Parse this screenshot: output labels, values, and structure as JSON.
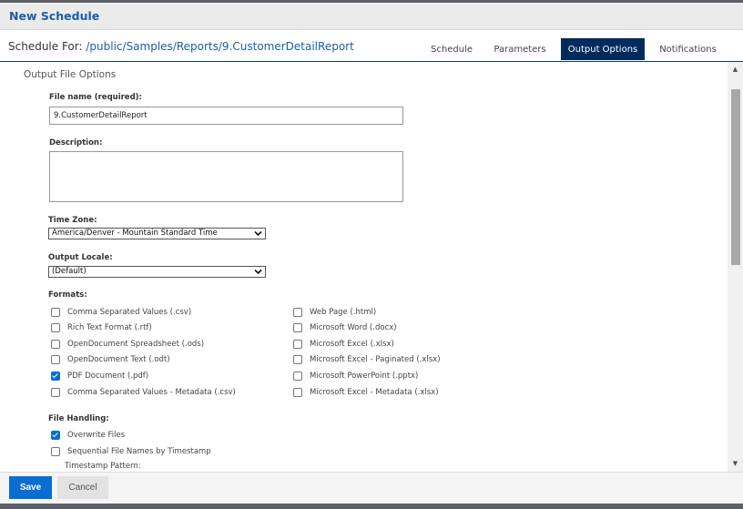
{
  "dialog": {
    "title": "New Schedule"
  },
  "header": {
    "schedule_for_label": "Schedule For:",
    "report_path": "/public/Samples/Reports/9.CustomerDetailReport",
    "tabs": [
      {
        "label": "Schedule",
        "active": false
      },
      {
        "label": "Parameters",
        "active": false
      },
      {
        "label": "Output Options",
        "active": true
      },
      {
        "label": "Notifications",
        "active": false
      }
    ]
  },
  "output": {
    "section_title": "Output File Options",
    "file_name_label": "File name (required):",
    "file_name_value": "9.CustomerDetailReport",
    "description_label": "Description:",
    "description_value": "",
    "timezone_label": "Time Zone:",
    "timezone_value": "America/Denver - Mountain Standard Time",
    "locale_label": "Output Locale:",
    "locale_value": "(Default)",
    "formats_label": "Formats:",
    "formats_left": [
      {
        "label": "Comma Separated Values (.csv)",
        "checked": false
      },
      {
        "label": "Rich Text Format (.rtf)",
        "checked": false
      },
      {
        "label": "OpenDocument Spreadsheet (.ods)",
        "checked": false
      },
      {
        "label": "OpenDocument Text (.odt)",
        "checked": false
      },
      {
        "label": "PDF Document (.pdf)",
        "checked": true
      },
      {
        "label": "Comma Separated Values - Metadata (.csv)",
        "checked": false
      }
    ],
    "formats_right": [
      {
        "label": "Web Page (.html)",
        "checked": false
      },
      {
        "label": "Microsoft Word (.docx)",
        "checked": false
      },
      {
        "label": "Microsoft Excel (.xlsx)",
        "checked": false
      },
      {
        "label": "Microsoft Excel - Paginated (.xlsx)",
        "checked": false
      },
      {
        "label": "Microsoft PowerPoint (.pptx)",
        "checked": false
      },
      {
        "label": "Microsoft Excel - Metadata (.xlsx)",
        "checked": false
      }
    ],
    "file_handling_label": "File Handling:",
    "file_handling": [
      {
        "label": "Overwrite Files",
        "checked": true
      },
      {
        "label": "Sequential File Names by Timestamp",
        "checked": false
      }
    ],
    "timestamp_pattern_label": "Timestamp Pattern:"
  },
  "footer": {
    "save_label": "Save",
    "cancel_label": "Cancel"
  },
  "colors": {
    "accent": "#0a6ed1",
    "title": "#1b5ea7",
    "active_tab": "#002b5c"
  }
}
